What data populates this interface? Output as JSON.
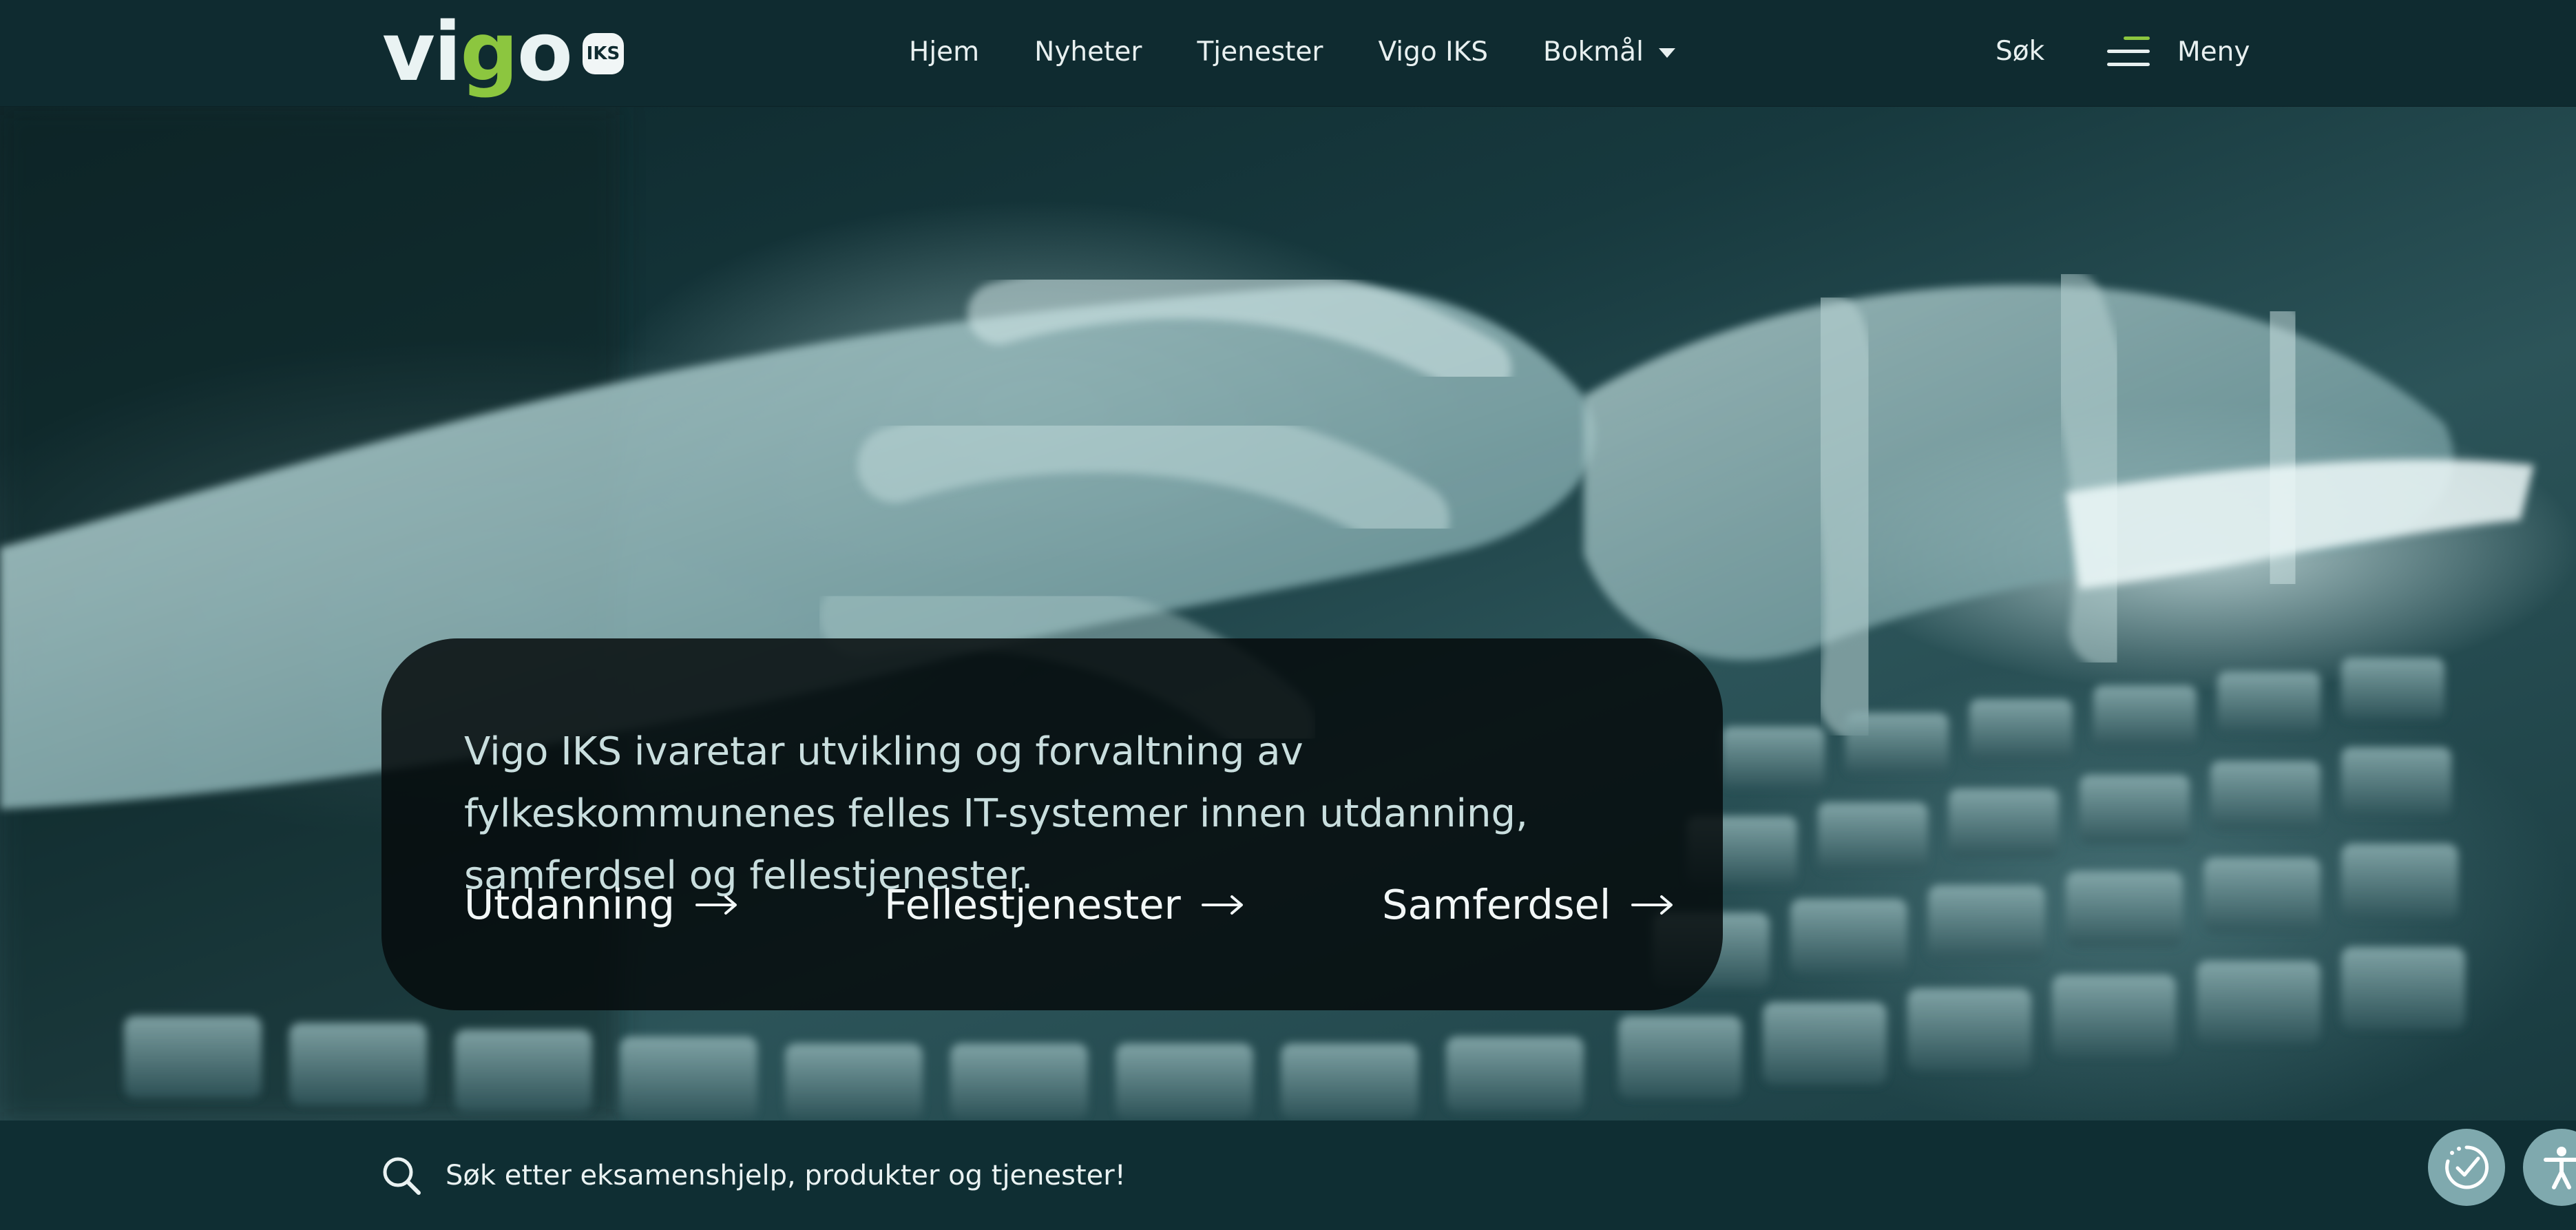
{
  "header": {
    "logo": {
      "wordmark": "vigo",
      "badge": "IKS"
    },
    "nav": [
      {
        "label": "Hjem"
      },
      {
        "label": "Nyheter"
      },
      {
        "label": "Tjenester"
      },
      {
        "label": "Vigo IKS"
      },
      {
        "label": "Bokmål"
      }
    ],
    "search_label": "Søk",
    "menu_label": "Meny"
  },
  "hero": {
    "text": "Vigo IKS ivaretar utvikling og forvaltning av fylkeskommunenes felles IT-systemer innen utdanning, samferdsel og fellestjenester.",
    "links": [
      {
        "label": "Utdanning"
      },
      {
        "label": "Fellestjenester"
      },
      {
        "label": "Samferdsel"
      }
    ]
  },
  "bottom_search": {
    "placeholder": "Søk etter eksamenshjelp, produkter og tjenester!"
  },
  "floating_buttons": {
    "left_icon": "clock-check-icon",
    "right_icon": "accessibility-icon"
  },
  "colors": {
    "header_bg": "#0f2b30",
    "brand_green": "#8cc63f",
    "card_bg": "#060c0d",
    "fab_bg": "#7fa9ae"
  }
}
